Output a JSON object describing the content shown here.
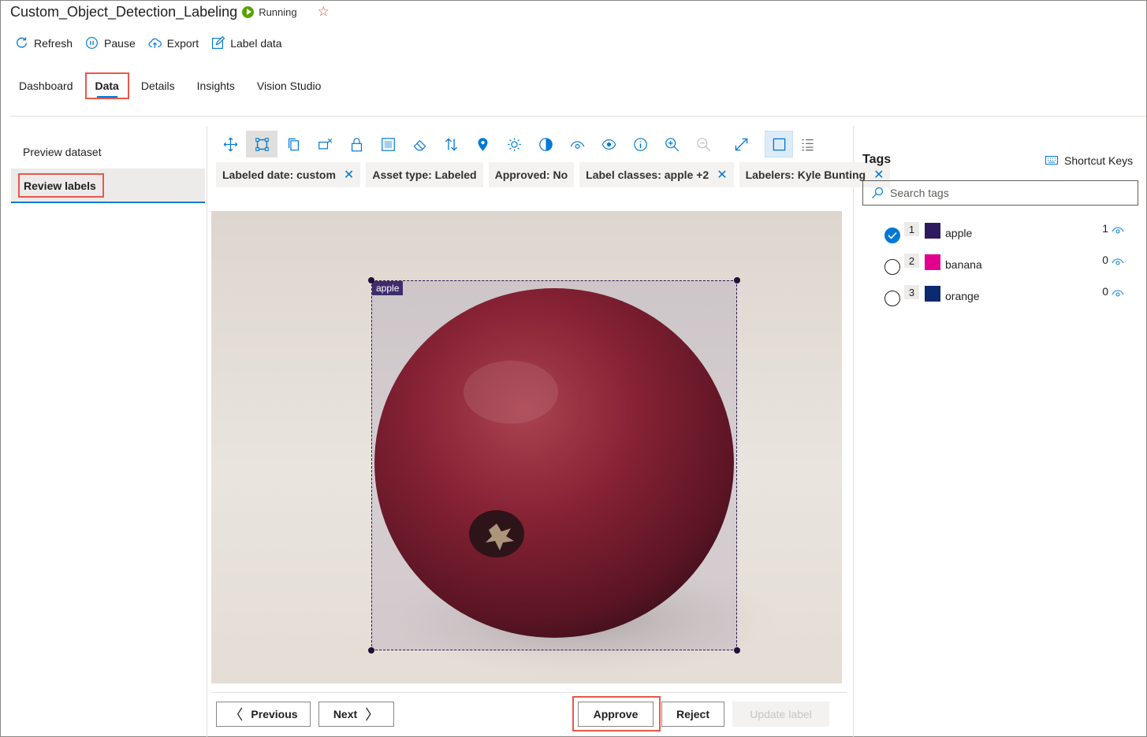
{
  "header": {
    "title": "Custom_Object_Detection_Labeling",
    "status": "Running",
    "favorite_icon": "star-icon"
  },
  "commands": [
    {
      "label": "Refresh",
      "icon": "refresh-icon"
    },
    {
      "label": "Pause",
      "icon": "pause-icon"
    },
    {
      "label": "Export",
      "icon": "cloud-export-icon"
    },
    {
      "label": "Label data",
      "icon": "edit-icon"
    }
  ],
  "tabs": [
    "Dashboard",
    "Data",
    "Details",
    "Insights",
    "Vision Studio"
  ],
  "active_tab": "Data",
  "leftnav": {
    "preview": "Preview dataset",
    "review": "Review labels"
  },
  "toolbar": [
    "move-icon",
    "rectangle-select-icon",
    "copy-icon",
    "remove-box-icon",
    "lock-icon",
    "region-icon",
    "eraser-icon",
    "sort-icon",
    "pin-icon",
    "brightness-icon",
    "contrast-icon",
    "hide-icon",
    "show-icon",
    "info-icon",
    "zoom-in-icon",
    "zoom-out-icon",
    "fit-icon",
    "single-view-icon",
    "list-view-icon"
  ],
  "filters": [
    {
      "label": "Labeled date: custom",
      "removable": true
    },
    {
      "label": "Asset type: Labeled",
      "removable": false
    },
    {
      "label": "Approved: No",
      "removable": false
    },
    {
      "label": "Label classes: apple +2",
      "removable": true
    },
    {
      "label": "Labelers: Kyle Bunting",
      "removable": true
    }
  ],
  "image": {
    "box_label": "apple"
  },
  "buttons": {
    "previous": "Previous",
    "next": "Next",
    "approve": "Approve",
    "reject": "Reject",
    "update": "Update label"
  },
  "tags_panel": {
    "title": "Tags",
    "shortcut": "Shortcut Keys",
    "search_placeholder": "Search tags",
    "tags": [
      {
        "key": "1",
        "name": "apple",
        "color": "#2e1a5e",
        "count": "1",
        "checked": true
      },
      {
        "key": "2",
        "name": "banana",
        "color": "#e3008c",
        "count": "0",
        "checked": false
      },
      {
        "key": "3",
        "name": "orange",
        "color": "#0b2a6f",
        "count": "0",
        "checked": false
      }
    ]
  }
}
